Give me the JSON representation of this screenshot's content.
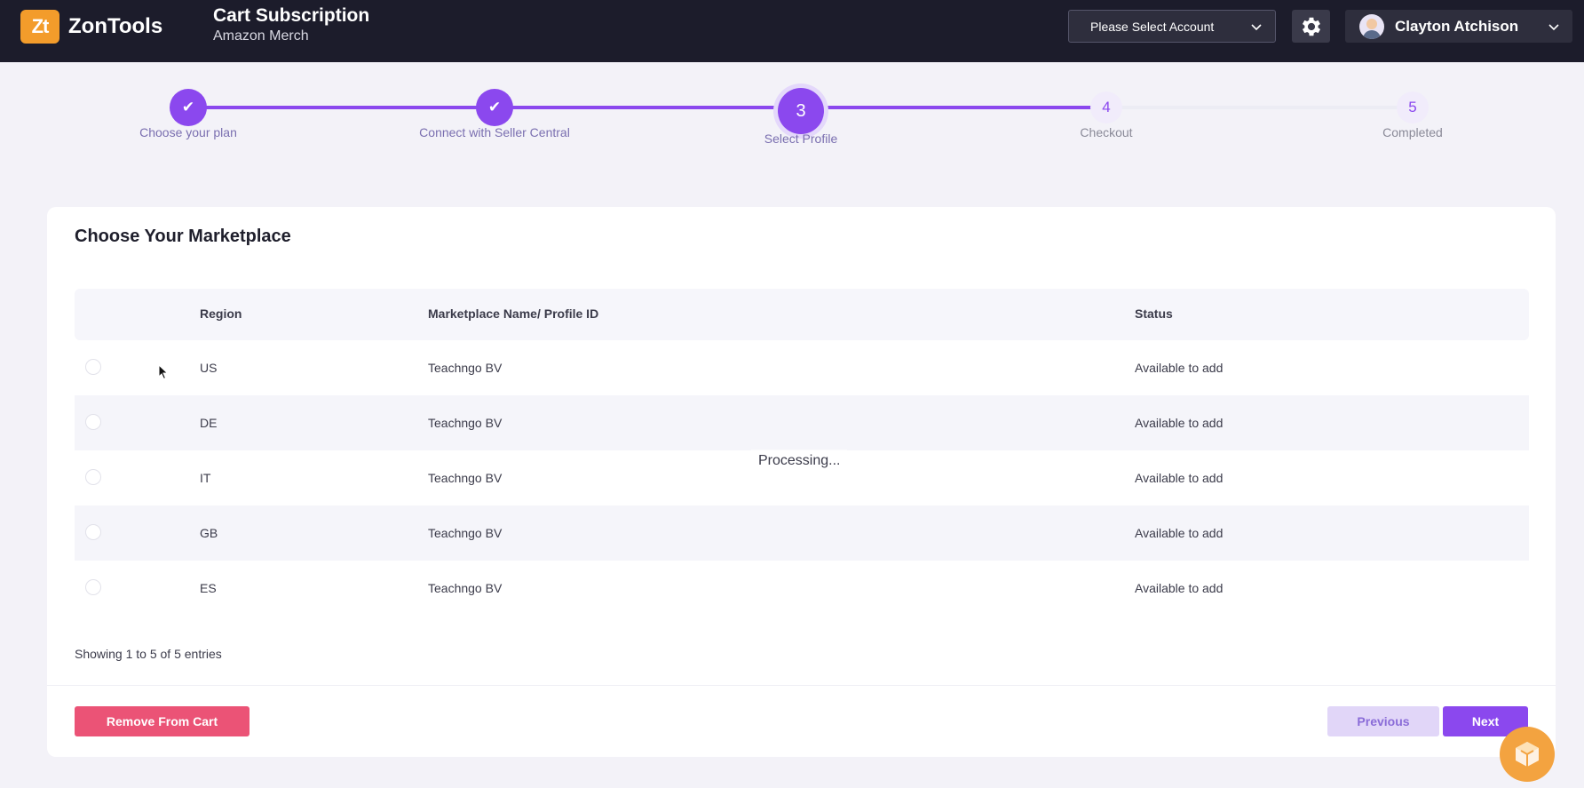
{
  "header": {
    "logo_mark": "Zt",
    "logo_text": "ZonTools",
    "title": "Cart Subscription",
    "subtitle": "Amazon Merch",
    "account_select": "Please Select Account",
    "user_name": "Clayton Atchison"
  },
  "stepper": {
    "steps": [
      {
        "number": "✔",
        "label": "Choose your plan",
        "state": "done"
      },
      {
        "number": "✔",
        "label": "Connect with Seller Central",
        "state": "done"
      },
      {
        "number": "3",
        "label": "Select Profile",
        "state": "current"
      },
      {
        "number": "4",
        "label": "Checkout",
        "state": "pending"
      },
      {
        "number": "5",
        "label": "Completed",
        "state": "pending"
      }
    ]
  },
  "card": {
    "title": "Choose Your Marketplace",
    "columns": [
      "Region",
      "Marketplace Name/ Profile ID",
      "Status"
    ],
    "rows": [
      {
        "region": "US",
        "name": "Teachngo BV",
        "status": "Available to add"
      },
      {
        "region": "DE",
        "name": "Teachngo BV",
        "status": "Available to add"
      },
      {
        "region": "IT",
        "name": "Teachngo BV",
        "status": "Available to add"
      },
      {
        "region": "GB",
        "name": "Teachngo BV",
        "status": "Available to add"
      },
      {
        "region": "ES",
        "name": "Teachngo BV",
        "status": "Available to add"
      }
    ],
    "processing": "Processing...",
    "entries_text": "Showing 1 to 5 of 5 entries",
    "remove_label": "Remove From Cart",
    "previous_label": "Previous",
    "next_label": "Next"
  },
  "colors": {
    "accent": "#8b48ee",
    "topbar": "#1c1c2b",
    "remove": "#eb5376",
    "logo": "#f39c2b"
  }
}
